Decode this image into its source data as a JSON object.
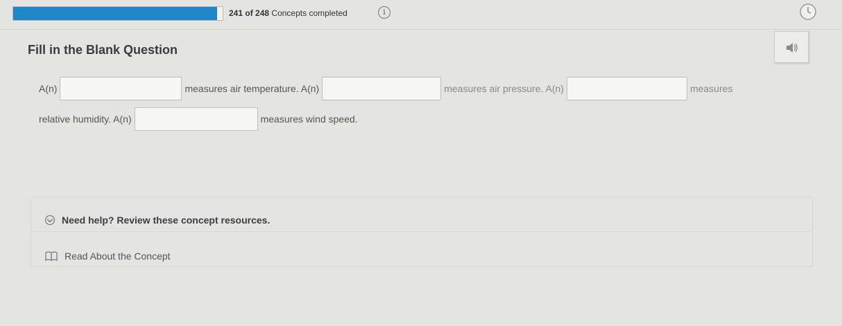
{
  "progress": {
    "completed": "241",
    "of_text": "of",
    "total": "248",
    "label": "Concepts completed",
    "fraction": 0.972
  },
  "icons": {
    "info": "info-icon",
    "timer": "timer-icon",
    "audio": "speaker-icon",
    "help_toggle": "chevron-down-icon",
    "read": "book-icon"
  },
  "question": {
    "title": "Fill in the Blank Question",
    "seg1": "A(n)",
    "seg2": "measures air temperature. A(n)",
    "seg3": "measures air pressure. A(n)",
    "seg4": "measures",
    "seg5": "relative humidity. A(n)",
    "seg6": "measures wind speed."
  },
  "resources": {
    "help_label": "Need help? Review these concept resources.",
    "read_label": "Read About the Concept"
  },
  "colors": {
    "progress_fill": "#1f86c7",
    "background": "#e4e4e2"
  }
}
